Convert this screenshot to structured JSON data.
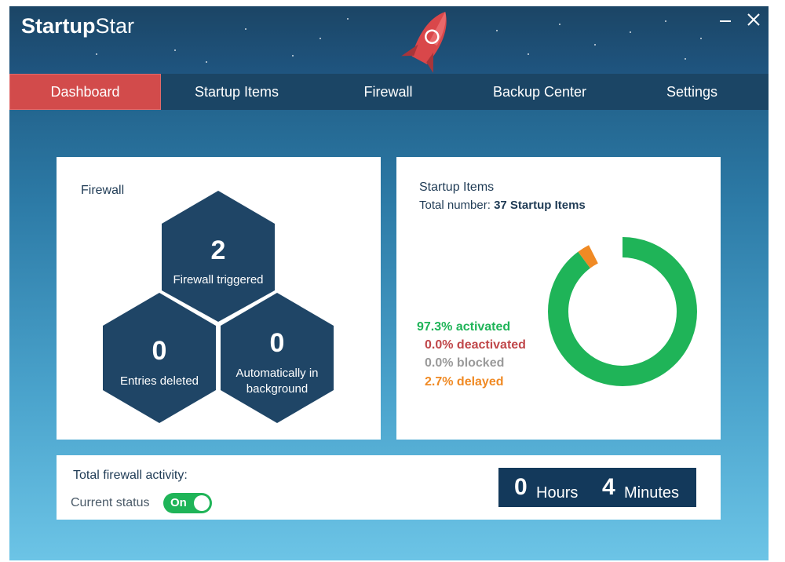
{
  "app": {
    "brand_bold": "Startup",
    "brand_light": "Star",
    "minimize_icon": "minimize-icon",
    "close_icon": "close-icon"
  },
  "nav": {
    "items": [
      {
        "label": "Dashboard",
        "active": true
      },
      {
        "label": "Startup Items",
        "active": false
      },
      {
        "label": "Firewall",
        "active": false
      },
      {
        "label": "Backup Center",
        "active": false
      },
      {
        "label": "Settings",
        "active": false
      }
    ]
  },
  "firewall_panel": {
    "title": "Firewall",
    "triggered": {
      "value": "2",
      "label": "Firewall triggered"
    },
    "deleted": {
      "value": "0",
      "label": "Entries deleted"
    },
    "auto": {
      "value": "0",
      "label_line1": "Automatically in",
      "label_line2": "background"
    }
  },
  "startup_panel": {
    "title": "Startup Items",
    "total_label": "Total number:",
    "total_value": "37 Startup Items",
    "legend": [
      {
        "text": "97.3% activated",
        "color": "#1fb458"
      },
      {
        "text": "0.0% deactivated",
        "color": "#c0474a"
      },
      {
        "text": "0.0% blocked",
        "color": "#9a9a9a"
      },
      {
        "text": "2.7% delayed",
        "color": "#f08a24"
      }
    ],
    "donut": [
      {
        "name": "activated",
        "percent": 97.3,
        "color": "#1fb458"
      },
      {
        "name": "delayed",
        "percent": 2.7,
        "color": "#f08a24"
      }
    ]
  },
  "activity": {
    "title": "Total firewall activity:",
    "status_label": "Current status",
    "toggle_text": "On",
    "toggle_on": true,
    "hours_value": "0",
    "hours_label": "Hours",
    "minutes_value": "4",
    "minutes_label": "Minutes"
  },
  "colors": {
    "accent_red": "#d24b4b",
    "navy": "#1b4565",
    "hex_fill": "#1f4566",
    "green": "#1fb458",
    "orange": "#f08a24"
  }
}
